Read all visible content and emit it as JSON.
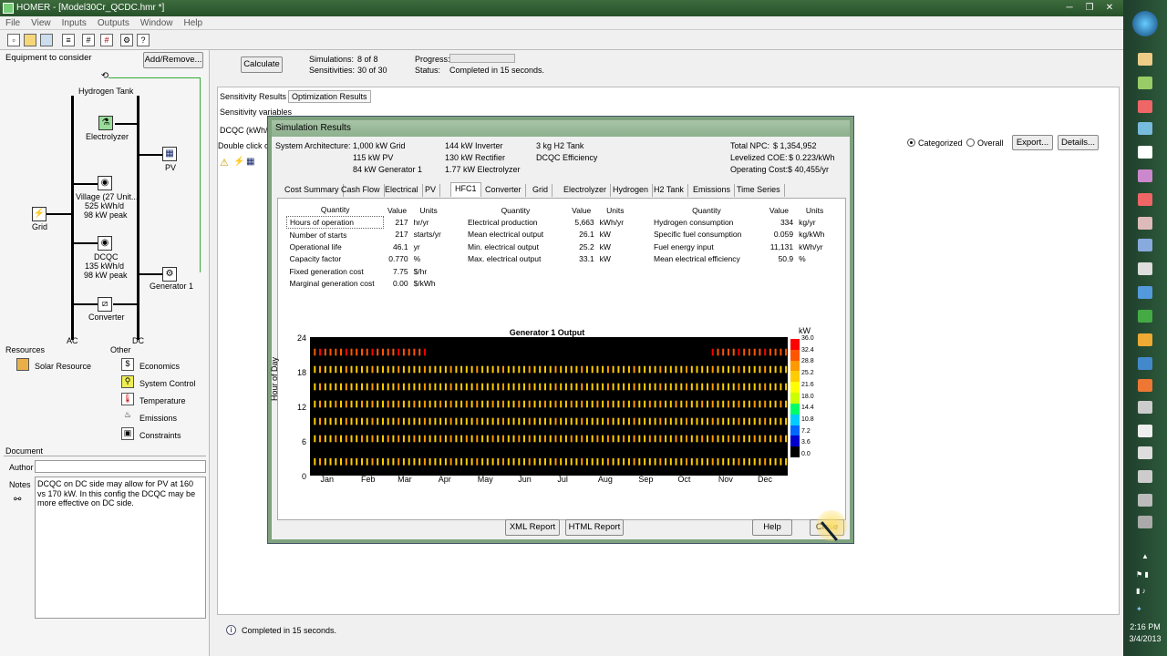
{
  "window": {
    "title": "HOMER - [Model30Cr_QCDC.hmr *]"
  },
  "menu": [
    "File",
    "View",
    "Inputs",
    "Outputs",
    "Window",
    "Help"
  ],
  "left": {
    "equipment_label": "Equipment to consider",
    "add_remove": "Add/Remove...",
    "components": {
      "hydrogen_tank": "Hydrogen Tank",
      "electrolyzer": "Electrolyzer",
      "pv": "PV",
      "village": "Village (27 Unit...",
      "village_kwh": "525 kWh/d",
      "village_peak": "98 kW peak",
      "grid": "Grid",
      "dcqc": "DCQC",
      "dcqc_kwh": "135 kWh/d",
      "dcqc_peak": "98 kW peak",
      "generator": "Generator 1",
      "converter": "Converter",
      "ac": "AC",
      "dc": "DC"
    },
    "resources_label": "Resources",
    "other_label": "Other",
    "solar_resource": "Solar Resource",
    "other_items": [
      "Economics",
      "System Control",
      "Temperature",
      "Emissions",
      "Constraints"
    ],
    "document_label": "Document",
    "author_label": "Author",
    "notes_label": "Notes",
    "notes_text": "DCQC on DC side may allow for PV at 160 vs 170 kW.  In this config the DCQC may be more effective on DC side."
  },
  "top": {
    "calculate": "Calculate",
    "simulations_label": "Simulations:",
    "simulations_value": "8 of 8",
    "sensitivities_label": "Sensitivities:",
    "sensitivities_value": "30 of 30",
    "progress_label": "Progress:",
    "status_label": "Status:",
    "status_value": "Completed in 15 seconds."
  },
  "results": {
    "tabs": [
      "Sensitivity Results",
      "Optimization Results"
    ],
    "sensitivity_variables": "Sensitivity variables",
    "dcqc_partial": "DCQC (kWh/",
    "double_click": "Double click o",
    "radio_categorized": "Categorized",
    "radio_overall": "Overall",
    "export": "Export...",
    "details": "Details..."
  },
  "dialog": {
    "title": "Simulation Results",
    "arch_label": "System Architecture:",
    "arch_col1": [
      "1,000 kW Grid",
      "115 kW PV",
      "84 kW Generator 1"
    ],
    "arch_col2": [
      "144 kW Inverter",
      "130 kW Rectifier",
      "1.77 kW Electrolyzer"
    ],
    "arch_col3": [
      "3 kg H2 Tank",
      "DCQC Efficiency"
    ],
    "totals": [
      {
        "label": "Total NPC:",
        "value": "$ 1,354,952"
      },
      {
        "label": "Levelized COE:",
        "value": "$ 0.223/kWh"
      },
      {
        "label": "Operating Cost:",
        "value": "$ 40,455/yr"
      }
    ],
    "tabs": [
      "Cost Summary",
      "Cash Flow",
      "Electrical",
      "PV",
      "HFC1",
      "Converter",
      "Grid",
      "Electrolyzer",
      "Hydrogen",
      "H2 Tank",
      "Emissions",
      "Time Series"
    ],
    "headers": {
      "quantity": "Quantity",
      "value": "Value",
      "units": "Units"
    },
    "table1": [
      [
        "Hours of operation",
        "217",
        "hr/yr"
      ],
      [
        "Number of starts",
        "217",
        "starts/yr"
      ],
      [
        "Operational life",
        "46.1",
        "yr"
      ],
      [
        "Capacity factor",
        "0.770",
        "%"
      ],
      [
        "Fixed generation cost",
        "7.75",
        "$/hr"
      ],
      [
        "Marginal generation cost",
        "0.00",
        "$/kWh"
      ]
    ],
    "table2": [
      [
        "Electrical production",
        "5,663",
        "kWh/yr"
      ],
      [
        "Mean electrical output",
        "26.1",
        "kW"
      ],
      [
        "Min. electrical output",
        "25.2",
        "kW"
      ],
      [
        "Max. electrical output",
        "33.1",
        "kW"
      ]
    ],
    "table3": [
      [
        "Hydrogen consumption",
        "334",
        "kg/yr"
      ],
      [
        "Specific fuel consumption",
        "0.059",
        "kg/kWh"
      ],
      [
        "Fuel energy input",
        "11,131",
        "kWh/yr"
      ],
      [
        "Mean electrical efficiency",
        "50.9",
        "%"
      ]
    ],
    "buttons": {
      "xml": "XML Report",
      "html": "HTML Report",
      "help": "Help",
      "close": "Close"
    }
  },
  "chart_data": {
    "type": "heatmap",
    "title": "Generator 1 Output",
    "xlabel": "",
    "ylabel": "Hour of Day",
    "x_ticks": [
      "Jan",
      "Feb",
      "Mar",
      "Apr",
      "May",
      "Jun",
      "Jul",
      "Aug",
      "Sep",
      "Oct",
      "Nov",
      "Dec"
    ],
    "y_ticks": [
      "0",
      "6",
      "12",
      "18",
      "24"
    ],
    "ylim": [
      0,
      24
    ],
    "colorbar_unit": "kW",
    "colorbar_ticks": [
      "36.0",
      "32.4",
      "28.8",
      "25.2",
      "21.6",
      "18.0",
      "14.4",
      "10.8",
      "7.2",
      "3.6",
      "0.0"
    ],
    "colorbar_colors": [
      "#ff0000",
      "#ff5500",
      "#ff9900",
      "#ffcc00",
      "#ffff00",
      "#ccff00",
      "#00ff66",
      "#00ccff",
      "#0066ff",
      "#0000cc",
      "#000000"
    ],
    "operating_hours": [
      {
        "hour": 2,
        "level": 26,
        "months": "all"
      },
      {
        "hour": 6,
        "level": 27,
        "months": "all"
      },
      {
        "hour": 9,
        "level": 26,
        "months": "all"
      },
      {
        "hour": 12,
        "level": 27,
        "months": "all"
      },
      {
        "hour": 15,
        "level": 26,
        "months": "all"
      },
      {
        "hour": 18,
        "level": 26,
        "months": "all"
      },
      {
        "hour": 21,
        "level": 33,
        "months": "Jan-Mar, Nov-Dec"
      }
    ]
  },
  "status": {
    "text": "Completed in 15 seconds."
  },
  "clock": {
    "time": "2:16 PM",
    "date": "3/4/2013"
  }
}
